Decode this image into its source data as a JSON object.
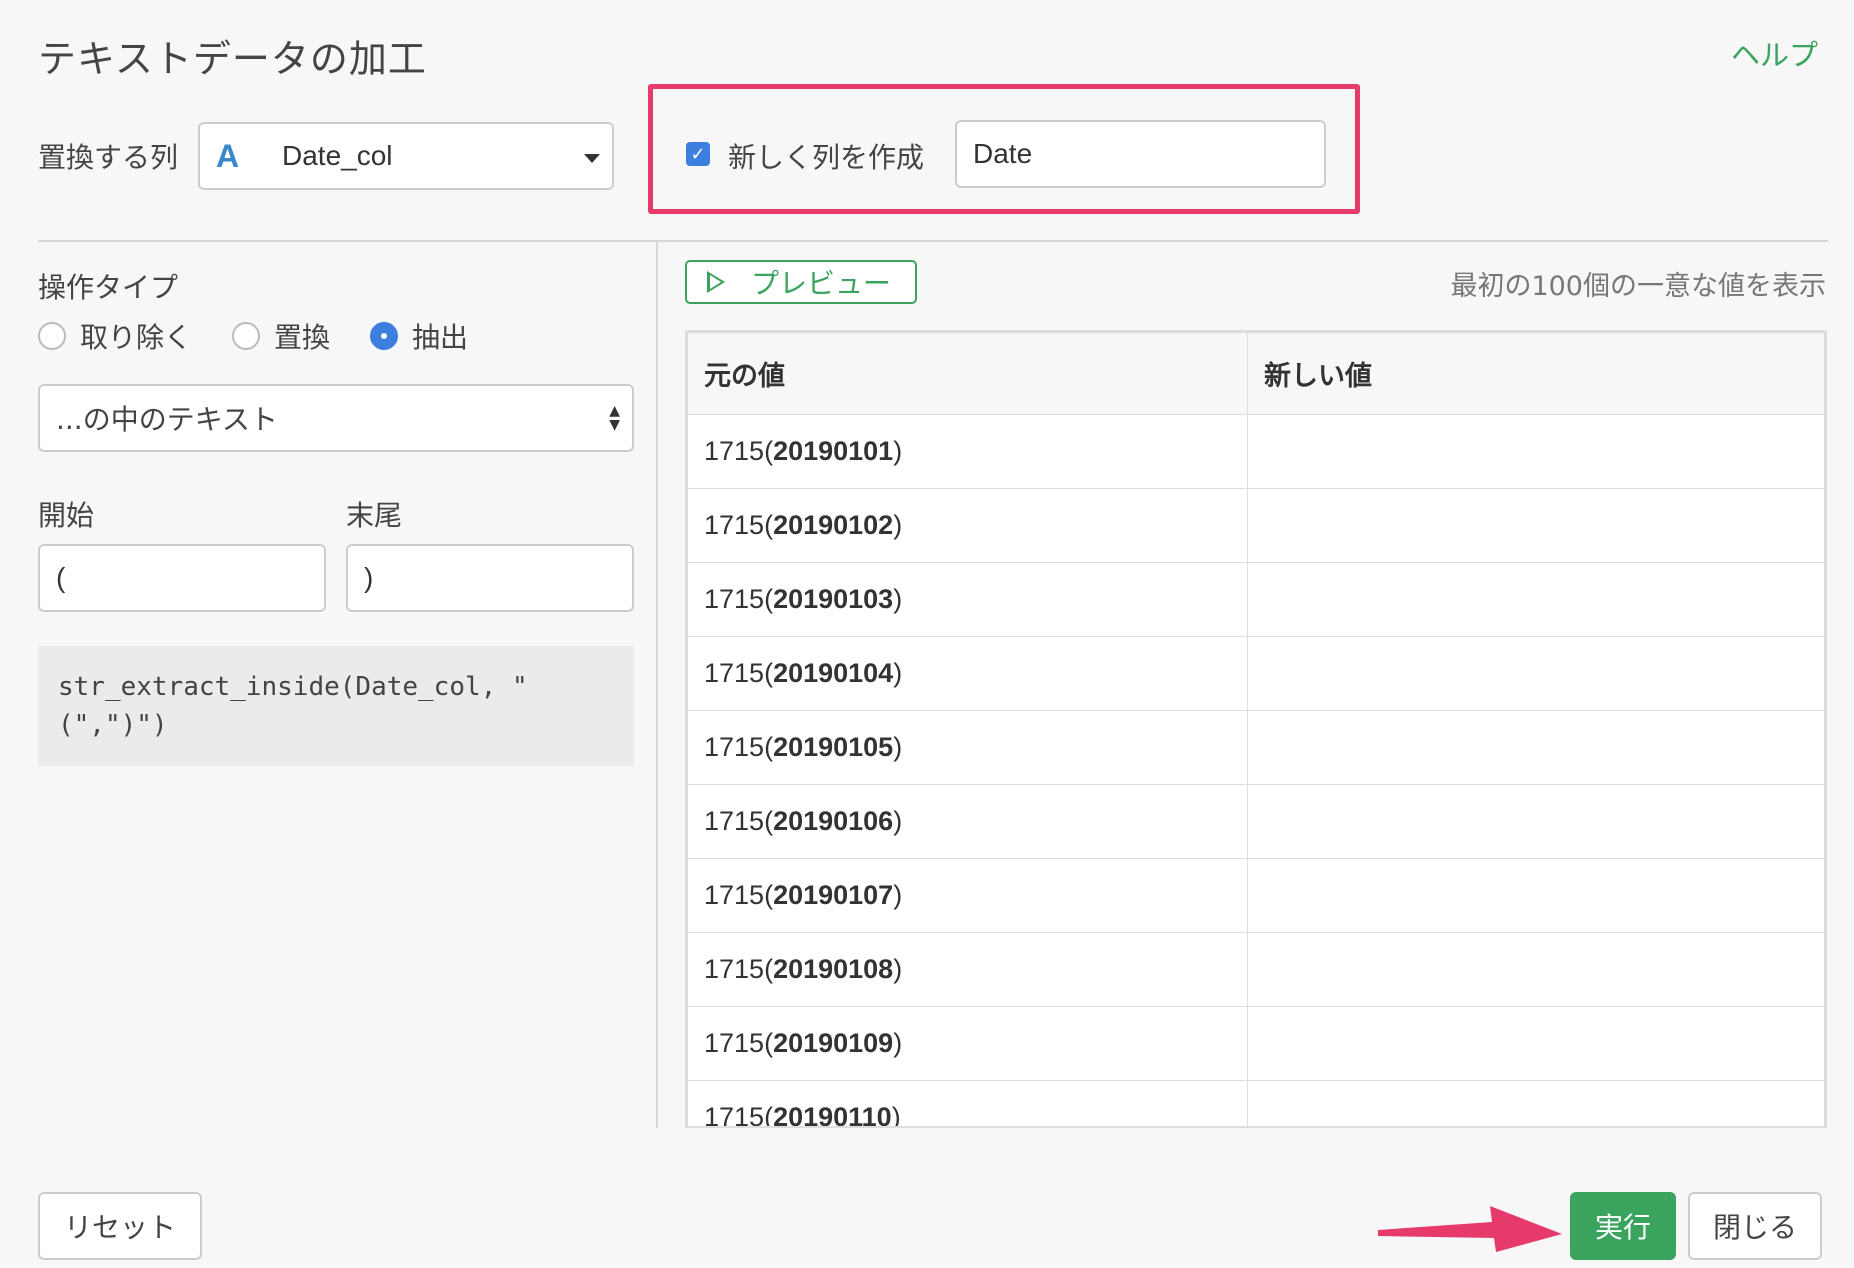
{
  "header": {
    "title": "テキストデータの加工",
    "help": "ヘルプ"
  },
  "column_select": {
    "label": "置換する列",
    "type_icon": "A",
    "value": "Date_col"
  },
  "new_column": {
    "checked": true,
    "label": "新しく列を作成",
    "value": "Date"
  },
  "operation": {
    "label": "操作タイプ",
    "options": [
      {
        "label": "取り除く",
        "selected": false
      },
      {
        "label": "置換",
        "selected": false
      },
      {
        "label": "抽出",
        "selected": true
      }
    ]
  },
  "mode_select": {
    "value": "...の中のテキスト"
  },
  "start": {
    "label": "開始",
    "value": "("
  },
  "end": {
    "label": "末尾",
    "value": ")"
  },
  "code": "str_extract_inside(Date_col, \"(\",\")\")",
  "preview": {
    "button": "プレビュー",
    "note": "最初の100個の一意な値を表示"
  },
  "table": {
    "headers": [
      "元の値",
      "新しい値"
    ],
    "rows": [
      {
        "prefix": "1715(",
        "bold": "20190101",
        "suffix": ")",
        "new": ""
      },
      {
        "prefix": "1715(",
        "bold": "20190102",
        "suffix": ")",
        "new": ""
      },
      {
        "prefix": "1715(",
        "bold": "20190103",
        "suffix": ")",
        "new": ""
      },
      {
        "prefix": "1715(",
        "bold": "20190104",
        "suffix": ")",
        "new": ""
      },
      {
        "prefix": "1715(",
        "bold": "20190105",
        "suffix": ")",
        "new": ""
      },
      {
        "prefix": "1715(",
        "bold": "20190106",
        "suffix": ")",
        "new": ""
      },
      {
        "prefix": "1715(",
        "bold": "20190107",
        "suffix": ")",
        "new": ""
      },
      {
        "prefix": "1715(",
        "bold": "20190108",
        "suffix": ")",
        "new": ""
      },
      {
        "prefix": "1715(",
        "bold": "20190109",
        "suffix": ")",
        "new": ""
      },
      {
        "prefix": "1715(",
        "bold": "20190110",
        "suffix": ")",
        "new": ""
      }
    ]
  },
  "footer": {
    "reset": "リセット",
    "run": "実行",
    "close": "閉じる"
  },
  "colors": {
    "accent_green": "#3aa35e",
    "highlight_pink": "#e63a6b",
    "checkbox_blue": "#3d7fe0"
  }
}
